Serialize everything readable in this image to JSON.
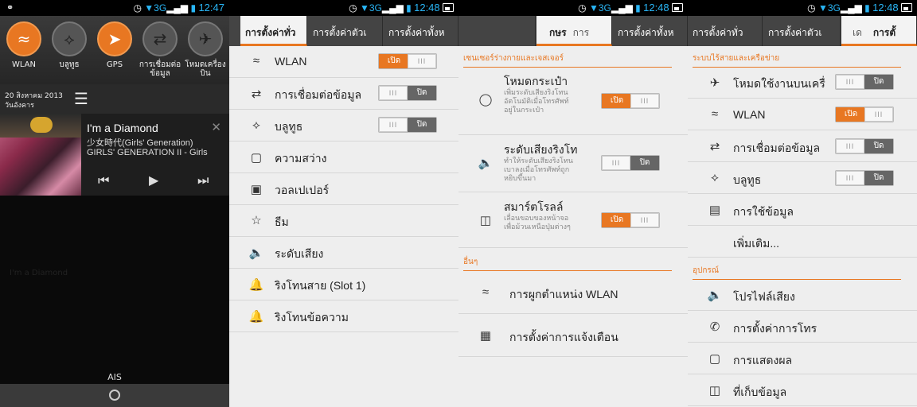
{
  "status": {
    "p1_time": "12:47",
    "p2_time": "12:48",
    "p3_time": "12:48",
    "p4_time": "12:48",
    "net": "3G"
  },
  "quick_settings": {
    "items": [
      {
        "label": "WLAN",
        "icon": "wifi-icon",
        "on": true
      },
      {
        "label": "บลูทูธ",
        "icon": "bluetooth-icon",
        "on": false
      },
      {
        "label": "GPS",
        "icon": "gps-icon",
        "on": true
      },
      {
        "label": "การเชื่อมต่อ ข้อมูล",
        "icon": "data-connection-icon",
        "on": false
      },
      {
        "label": "โหมดเครื่องบิน",
        "icon": "airplane-icon",
        "on": false
      }
    ],
    "date": "20 สิงหาคม 2013",
    "weekday": "วันอังคาร"
  },
  "music": {
    "title": "I'm a Diamond",
    "artist": "少女時代(Girls' Generation)",
    "album": "GIRLS' GENERATION II - Girls",
    "ghost_text": "I'm a Diamond"
  },
  "carrier": "AIS",
  "panel2": {
    "tabs": [
      "การตั้งค่าทั่ว",
      "การตั้งค่าตัวเ",
      "การตั้งค่าทั้งห",
      "การตั้งค่าทั่ว"
    ],
    "rows": [
      {
        "label": "WLAN",
        "icon": "wifi-icon",
        "toggle": "on"
      },
      {
        "label": "การเชื่อมต่อข้อมูล",
        "icon": "data-connection-icon",
        "toggle": "off"
      },
      {
        "label": "บลูทูธ",
        "icon": "bluetooth-icon",
        "toggle": "off"
      },
      {
        "label": "ความสว่าง",
        "icon": "brightness-icon"
      },
      {
        "label": "วอลเปเปอร์",
        "icon": "wallpaper-icon"
      },
      {
        "label": "ธีม",
        "icon": "theme-icon"
      },
      {
        "label": "ระดับเสียง",
        "icon": "volume-icon"
      },
      {
        "label": "ริงโทนสาย (Slot 1)",
        "icon": "ringtone-icon"
      },
      {
        "label": "ริงโทนข้อความ",
        "icon": "message-tone-icon"
      }
    ],
    "on_label": "เปิด",
    "off_label": "ปิด"
  },
  "panel3": {
    "tabs": [
      "กษร",
      "การ",
      "การตั้งค่าทั้งห"
    ],
    "section1": "เซนเซอร์ร่างกายและเจสเจอร์",
    "rows": [
      {
        "label": "โหมดกระเป๋า",
        "desc": "เพิ่มระดับเสียงริงโทนอัตโนมัติเมื่อโทรศัพท์อยู่ในกระเป๋า",
        "icon": "pocket-icon",
        "toggle": "on"
      },
      {
        "label": "ระดับเสียงริงโท",
        "desc": "ทำให้ระดับเสียงริงโทนเบาลงเมื่อโทรศัพท์ถูกหยิบขึ้นมา",
        "icon": "ringer-volume-icon",
        "toggle": "off"
      },
      {
        "label": "สมาร์ตโรลล์",
        "desc": "เลื่อนขอบของหน้าจอเพื่อม้วนเหนือปุ่มต่างๆ",
        "icon": "smart-scroll-icon",
        "toggle": "on"
      }
    ],
    "section2": "อื่นๆ",
    "other": [
      {
        "label": "การผูกตำแหน่ง WLAN",
        "icon": "wlan-location-icon"
      },
      {
        "label": "การตั้งค่าการแจ้งเตือน",
        "icon": "notification-settings-icon"
      }
    ]
  },
  "panel4": {
    "tabs": [
      "การตั้งค่าทั่ว",
      "การตั้งค่าตัวเ",
      "เด",
      "การตั้"
    ],
    "section1": "ระบบไร้สายและเครือข่าย",
    "rows": [
      {
        "label": "โหมดใช้งานบนเครื่",
        "icon": "airplane-icon",
        "toggle": "off"
      },
      {
        "label": "WLAN",
        "icon": "wifi-icon",
        "toggle": "on"
      },
      {
        "label": "การเชื่อมต่อข้อมูล",
        "icon": "data-connection-icon",
        "toggle": "off"
      },
      {
        "label": "บลูทูธ",
        "icon": "bluetooth-icon",
        "toggle": "off"
      },
      {
        "label": "การใช้ข้อมูล",
        "icon": "data-usage-icon"
      },
      {
        "label": "เพิ่มเติม...",
        "icon": ""
      }
    ],
    "section2": "อุปกรณ์",
    "device": [
      {
        "label": "โปรไฟล์เสียง",
        "icon": "sound-profile-icon"
      },
      {
        "label": "การตั้งค่าการโทร",
        "icon": "call-settings-icon"
      },
      {
        "label": "การแสดงผล",
        "icon": "display-icon"
      },
      {
        "label": "ที่เก็บข้อมูล",
        "icon": "storage-icon"
      }
    ]
  }
}
